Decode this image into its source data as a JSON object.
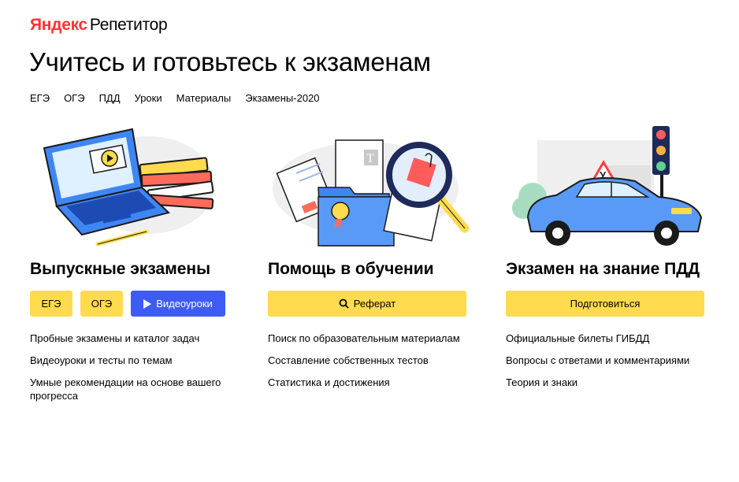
{
  "header": {
    "logo_brand": "Яндекс",
    "logo_product": "Репетитор",
    "headline": "Учитесь и готовьтесь к экзаменам"
  },
  "nav": {
    "items": [
      "ЕГЭ",
      "ОГЭ",
      "ПДД",
      "Уроки",
      "Материалы",
      "Экзамены-2020"
    ]
  },
  "cards": [
    {
      "title": "Выпускные экзамены",
      "buttons": [
        "ЕГЭ",
        "ОГЭ",
        "Видеоуроки"
      ],
      "links": [
        "Пробные экзамены и каталог задач",
        "Видеоуроки и тесты по темам",
        "Умные рекомендации на основе вашего прогресса"
      ]
    },
    {
      "title": "Помощь в обучении",
      "buttons": [
        "Реферат"
      ],
      "links": [
        "Поиск по образовательным материалам",
        "Составление собственных тестов",
        "Статистика и достижения"
      ]
    },
    {
      "title": "Экзамен на знание ПДД",
      "buttons": [
        "Подготовиться"
      ],
      "links": [
        "Официальные билеты ГИБДД",
        "Вопросы с ответами и комментариями",
        "Теория и знаки"
      ]
    }
  ],
  "colors": {
    "brand_red": "#ff3333",
    "button_yellow": "#ffdb4d",
    "video_blue": "#3f5bf5"
  }
}
